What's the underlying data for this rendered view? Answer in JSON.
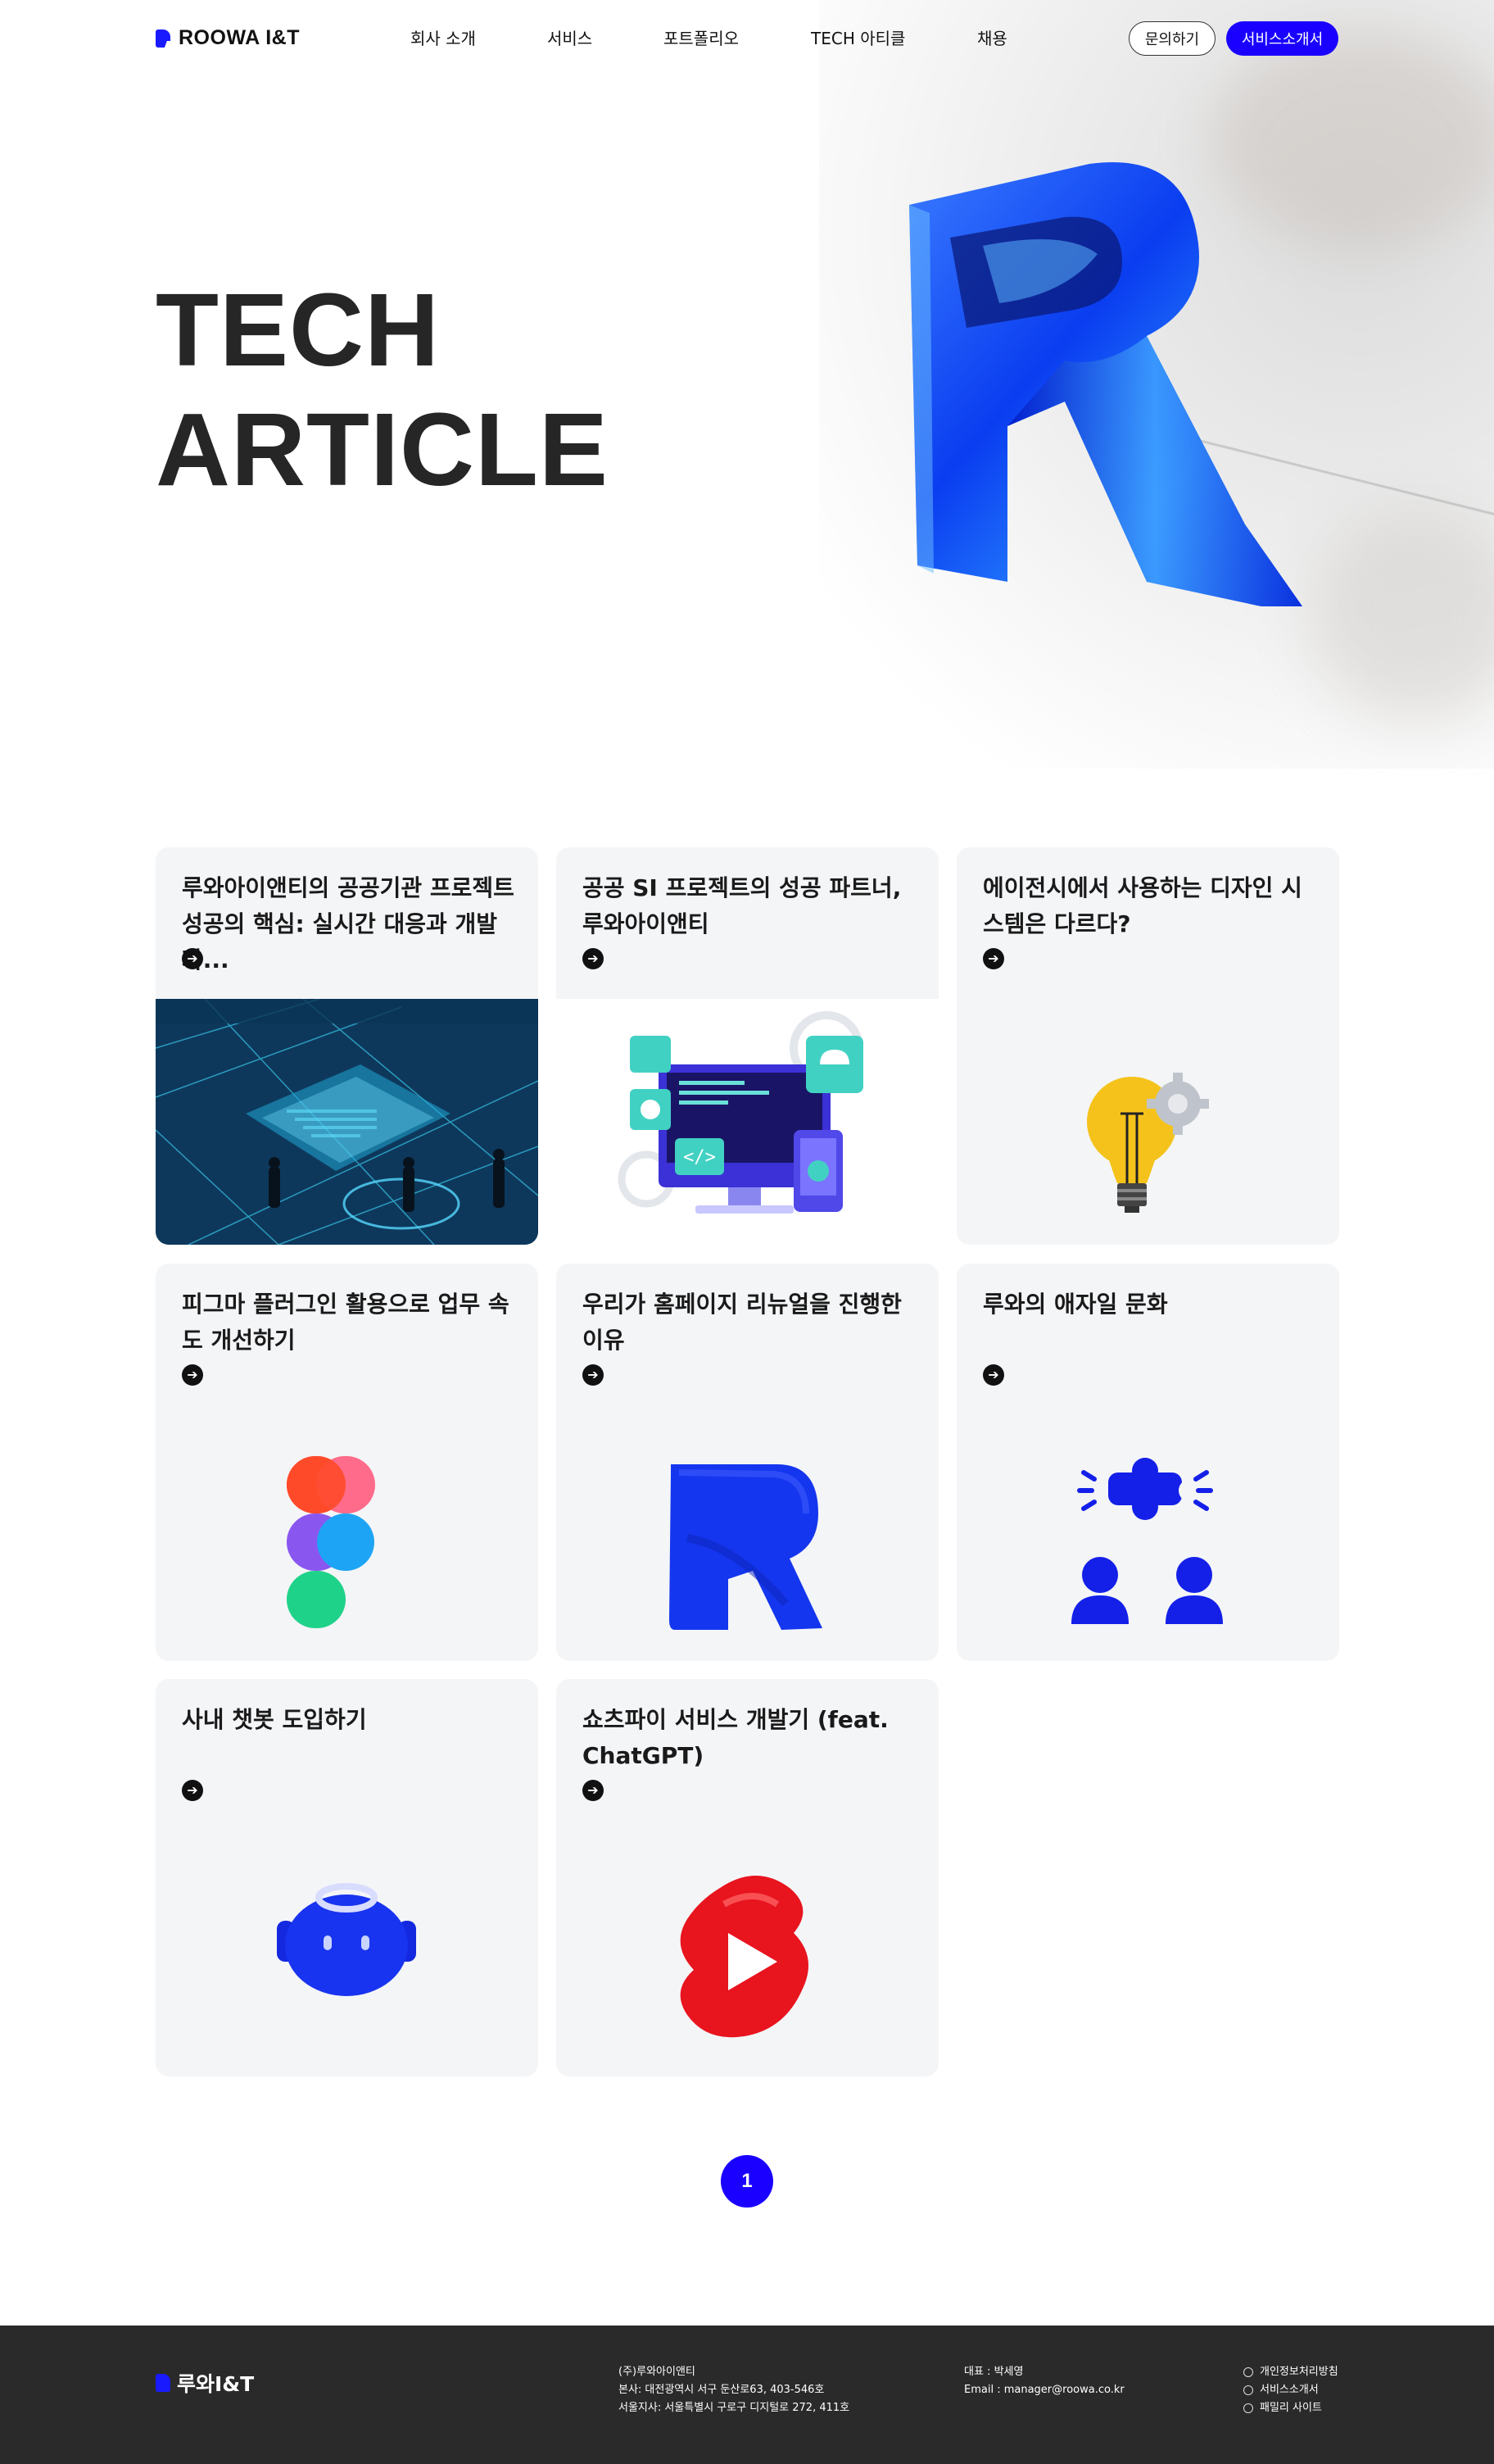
{
  "header": {
    "logo_text": "ROOWA I&T",
    "nav": [
      "회사 소개",
      "서비스",
      "포트폴리오",
      "TECH 아티클",
      "채용"
    ],
    "contact_label": "문의하기",
    "brochure_label": "서비스소개서"
  },
  "hero": {
    "title_line1": "TECH",
    "title_line2": "ARTICLE"
  },
  "articles": [
    {
      "title": "루와아이앤티의 공공기관 프로젝트 성공의 핵심: 실시간 대응과 개발자..."
    },
    {
      "title": "공공 SI 프로젝트의 성공 파트너, 루와아이앤티"
    },
    {
      "title": "에이전시에서 사용하는 디자인 시스템은 다르다?"
    },
    {
      "title": "피그마 플러그인 활용으로 업무 속도 개선하기"
    },
    {
      "title": "우리가 홈페이지 리뉴얼을 진행한 이유"
    },
    {
      "title": "루와의 애자일 문화"
    },
    {
      "title": "사내 챗봇 도입하기"
    },
    {
      "title": "쇼츠파이 서비스 개발기 (feat. ChatGPT)"
    }
  ],
  "pagination": {
    "current": "1"
  },
  "footer": {
    "logo_text": "루와I&T",
    "company": "(주)루와아이앤티",
    "hq": "본사: 대전광역시 서구 둔산로63, 403-546호",
    "seoul": "서울지사: 서울특별시 구로구 디지털로 272, 411호",
    "ceo": "대표 : 박세영",
    "email": "Email : manager@roowa.co.kr",
    "links": [
      "개인정보처리방침",
      "서비스소개서",
      "패밀리 사이트"
    ]
  },
  "colors": {
    "accent": "#1a00ff",
    "card_bg": "#f4f5f7",
    "footer_bg": "#2a2a2a"
  }
}
